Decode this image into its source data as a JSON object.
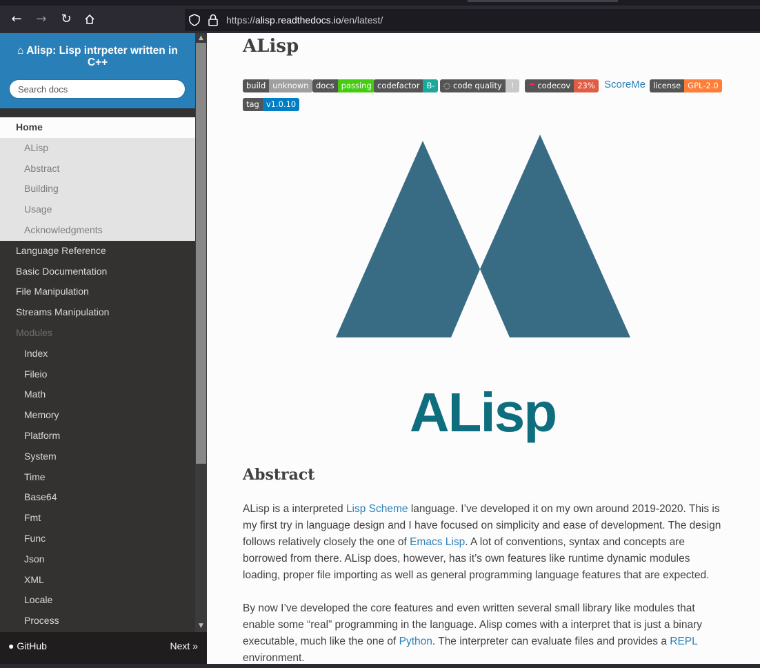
{
  "browser": {
    "url_prefix": "https://",
    "url_host": "alisp.readthedocs.io",
    "url_path": "/en/latest/"
  },
  "sidebar": {
    "project_title": "Alisp: Lisp intrpeter written in C++",
    "search_placeholder": "Search docs",
    "nav": [
      {
        "label": "Home",
        "kind": "current"
      },
      {
        "label": "ALisp",
        "kind": "sub"
      },
      {
        "label": "Abstract",
        "kind": "sub"
      },
      {
        "label": "Building",
        "kind": "sub"
      },
      {
        "label": "Usage",
        "kind": "sub"
      },
      {
        "label": "Acknowledgments",
        "kind": "sub"
      },
      {
        "label": "Language Reference",
        "kind": "top"
      },
      {
        "label": "Basic Documentation",
        "kind": "top"
      },
      {
        "label": "File Manipulation",
        "kind": "top"
      },
      {
        "label": "Streams Manipulation",
        "kind": "top"
      },
      {
        "label": "Modules",
        "kind": "caption"
      },
      {
        "label": "Index",
        "kind": "mod"
      },
      {
        "label": "Fileio",
        "kind": "mod"
      },
      {
        "label": "Math",
        "kind": "mod"
      },
      {
        "label": "Memory",
        "kind": "mod"
      },
      {
        "label": "Platform",
        "kind": "mod"
      },
      {
        "label": "System",
        "kind": "mod"
      },
      {
        "label": "Time",
        "kind": "mod"
      },
      {
        "label": "Base64",
        "kind": "mod"
      },
      {
        "label": "Fmt",
        "kind": "mod"
      },
      {
        "label": "Func",
        "kind": "mod"
      },
      {
        "label": "Json",
        "kind": "mod"
      },
      {
        "label": "XML",
        "kind": "mod"
      },
      {
        "label": "Locale",
        "kind": "mod"
      },
      {
        "label": "Process",
        "kind": "mod"
      }
    ],
    "footer": {
      "github": "GitHub",
      "next": "Next »"
    }
  },
  "content": {
    "title": "ALisp",
    "badges": {
      "build": {
        "label": "build",
        "value": "unknown",
        "color": "#9f9f9f"
      },
      "docs": {
        "label": "docs",
        "value": "passing",
        "color": "#4c1"
      },
      "codefactor": {
        "label": "codefactor",
        "value": "B-",
        "color": "#1aa89a"
      },
      "codequality": {
        "label": "code quality",
        "value": "!",
        "color": "#c9c9c9"
      },
      "codecov": {
        "label": "codecov",
        "value": "23%",
        "color": "#e05d44"
      },
      "license": {
        "label": "license",
        "value": "GPL-2.0",
        "color": "#fe7d37"
      },
      "tag": {
        "label": "tag",
        "value": "v1.0.10",
        "color": "#007ec6"
      }
    },
    "scoreme": "ScoreMe",
    "logo_text": "ALisp",
    "abstract_heading": "Abstract",
    "p1": {
      "t1": "ALisp is a interpreted ",
      "link1": "Lisp Scheme",
      "t2": " language. I’ve developed it on my own around 2019-2020. This is my first try in language design and I have focused on simplicity and ease of development. The design follows relatively closely the one of ",
      "link2": "Emacs Lisp",
      "t3": ". A lot of conventions, syntax and concepts are borrowed from there. ALisp does, however, has it’s own features like runtime dynamic modules loading, proper file importing as well as general programming language features that are expected."
    },
    "p2": {
      "t1": "By now I’ve developed the core features and even written several small library like modules that enable some “real” programming in the language. Alisp comes with a interpret that is just a binary executable, much like the one of ",
      "link1": "Python",
      "t2": ". The interpreter can evaluate files and provides a ",
      "link2": "REPL",
      "t3": " environment."
    },
    "logo_color": "#386b84",
    "accent_color": "#2980b9"
  }
}
